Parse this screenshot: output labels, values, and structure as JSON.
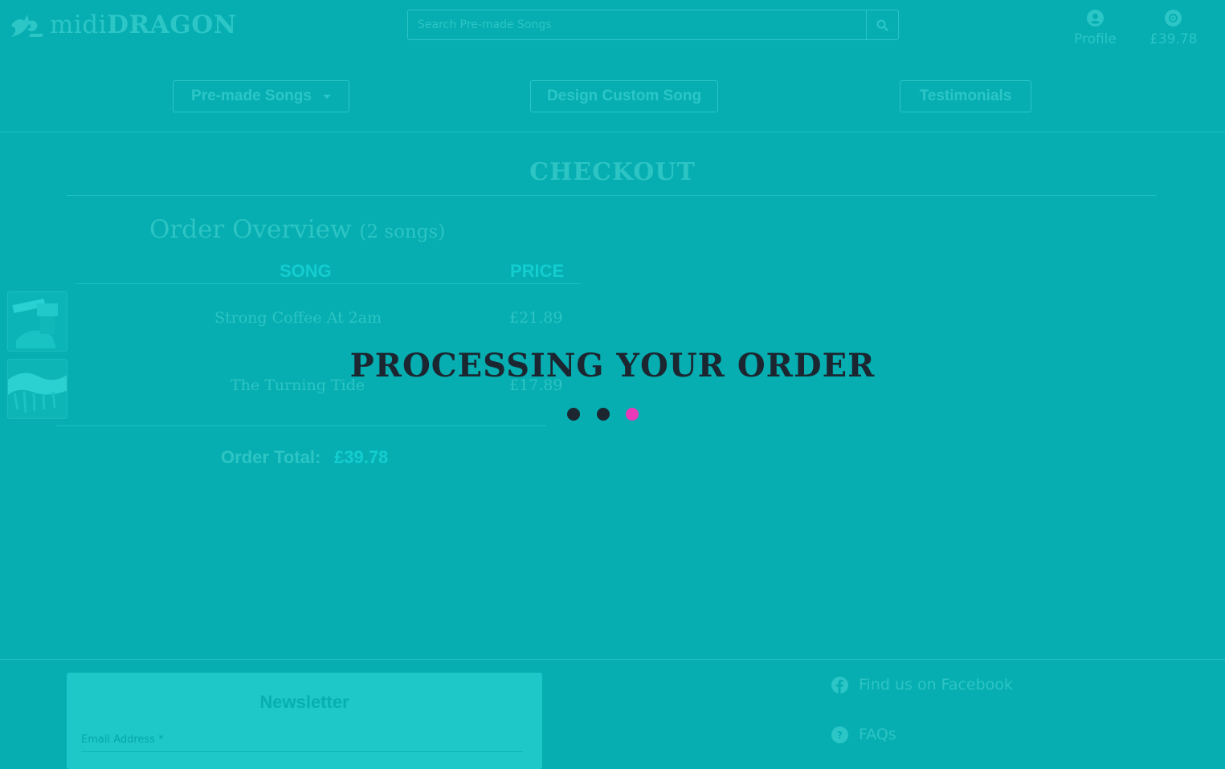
{
  "header": {
    "logo_light": "midi",
    "logo_bold": "DRAGON",
    "search_placeholder": "Search Pre-made Songs",
    "profile_label": "Profile",
    "cart_total": "£39.78"
  },
  "nav": {
    "premade": "Pre-made Songs",
    "custom": "Design Custom Song",
    "testimonials": "Testimonials"
  },
  "checkout": {
    "title": "CHECKOUT",
    "overview_title": "Order Overview",
    "song_count": "(2 songs)",
    "col_song": "SONG",
    "col_price": "PRICE",
    "items": [
      {
        "name": "Strong Coffee At 2am",
        "price": "£21.89"
      },
      {
        "name": "The Turning Tide",
        "price": "£17.89"
      }
    ],
    "total_label": "Order Total:",
    "total_value": "£39.78"
  },
  "overlay": {
    "message": "PROCESSING YOUR ORDER",
    "dot_colors": [
      "#1c2630",
      "#1c2630",
      "#e83ab8"
    ]
  },
  "footer": {
    "newsletter_title": "Newsletter",
    "email_label": "Email Address",
    "email_required": "*",
    "facebook": "Find us on Facebook",
    "faqs": "FAQs"
  },
  "colors": {
    "background": "#06aeb1",
    "faded_text": "#2cc6c7",
    "price_accent": "#14cdd0"
  }
}
